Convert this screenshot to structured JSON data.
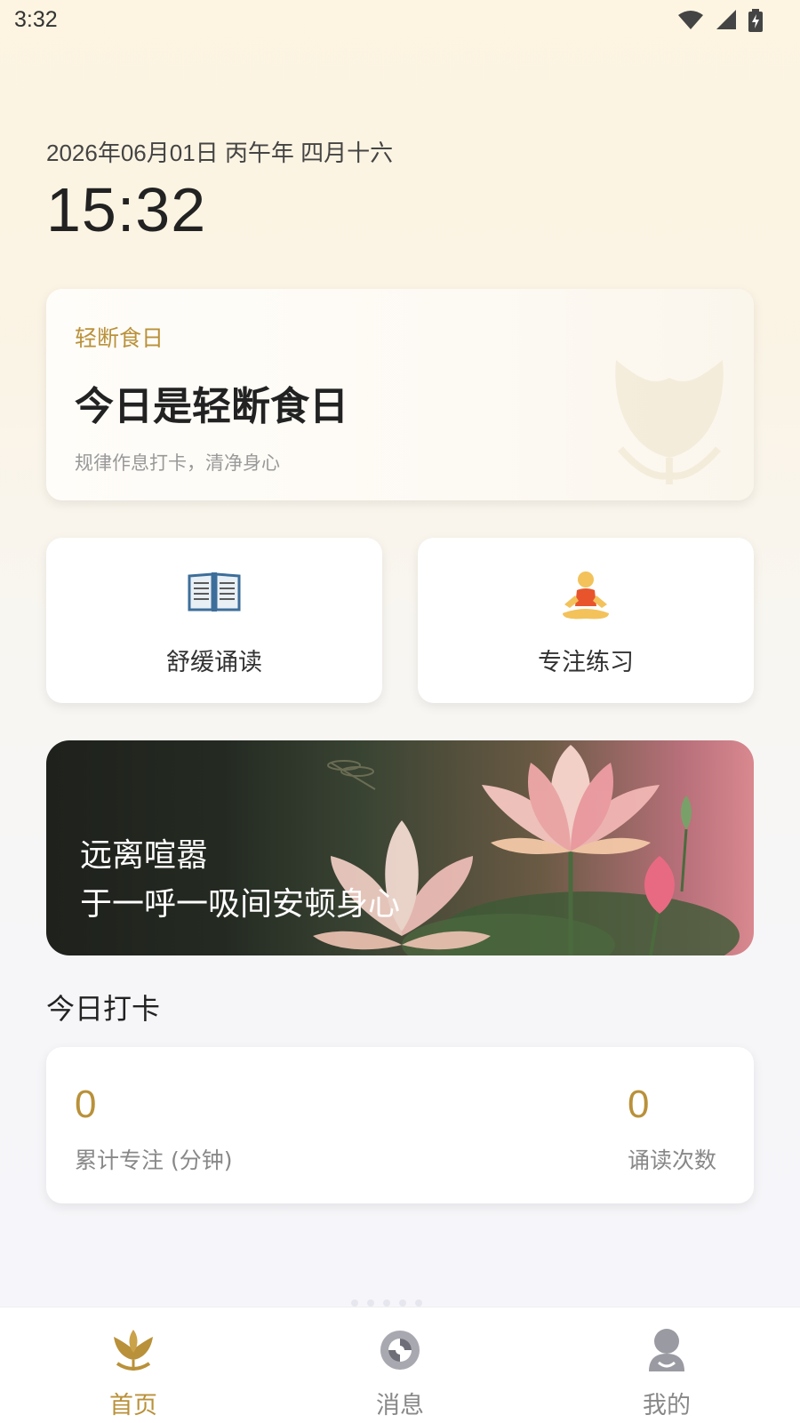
{
  "status_bar": {
    "time": "3:32"
  },
  "header": {
    "date_line": "2026年06月01日 丙午年 四月十六",
    "clock": "15:32"
  },
  "fast_card": {
    "tag": "轻断食日",
    "title": "今日是轻断食日",
    "subtitle": "规律作息打卡，清净身心"
  },
  "actions": [
    {
      "label": "舒缓诵读",
      "icon": "open-book-icon"
    },
    {
      "label": "专注练习",
      "icon": "meditation-icon"
    }
  ],
  "banner": {
    "line1": "远离喧嚣",
    "line2": "于一呼一吸间安顿身心"
  },
  "checkin": {
    "title": "今日打卡",
    "focus_value": "0",
    "focus_label": "累计专注 (分钟)",
    "read_value": "0",
    "read_label": "诵读次数"
  },
  "nav": [
    {
      "label": "首页",
      "icon": "lotus-icon",
      "active": true
    },
    {
      "label": "消息",
      "icon": "swirl-icon",
      "active": false
    },
    {
      "label": "我的",
      "icon": "profile-icon",
      "active": false
    }
  ],
  "colors": {
    "accent": "#b9913a",
    "text": "#222222",
    "muted": "#888888"
  }
}
